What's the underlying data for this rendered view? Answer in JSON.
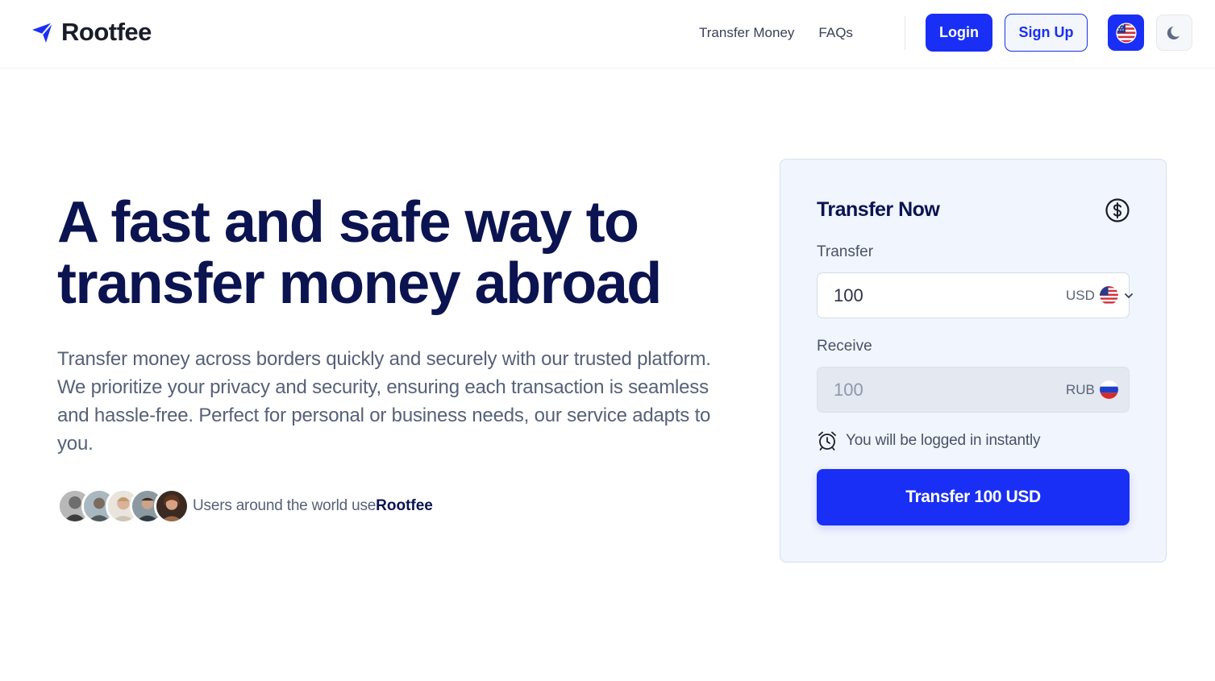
{
  "brand": {
    "name": "Rootfee"
  },
  "nav": {
    "items": [
      {
        "label": "Transfer Money"
      },
      {
        "label": "FAQs"
      }
    ],
    "login_label": "Login",
    "signup_label": "Sign Up",
    "language_icon": "us-flag-icon",
    "theme_icon": "moon-icon"
  },
  "hero": {
    "title": "A fast and safe way to transfer money abroad",
    "description": "Transfer money across borders quickly and securely with our trusted platform. We prioritize your privacy and security, ensuring each transaction is seamless and hassle-free. Perfect for personal or business needs, our service adapts to you.",
    "social_text": "Users around the world use ",
    "social_brand": "Rootfee",
    "avatar_count": 5
  },
  "card": {
    "title": "Transfer Now",
    "title_icon": "dollar-circle-icon",
    "transfer_label": "Transfer",
    "transfer_value": "100",
    "transfer_currency": "USD",
    "receive_label": "Receive",
    "receive_value": "100",
    "receive_currency": "RUB",
    "note": "You will be logged in instantly",
    "note_icon": "alarm-clock-icon",
    "button_label": "Transfer 100 USD"
  },
  "colors": {
    "primary": "#1a2ff5",
    "heading": "#0b1450",
    "body_text": "#566178",
    "card_bg": "#f1f5fd"
  }
}
